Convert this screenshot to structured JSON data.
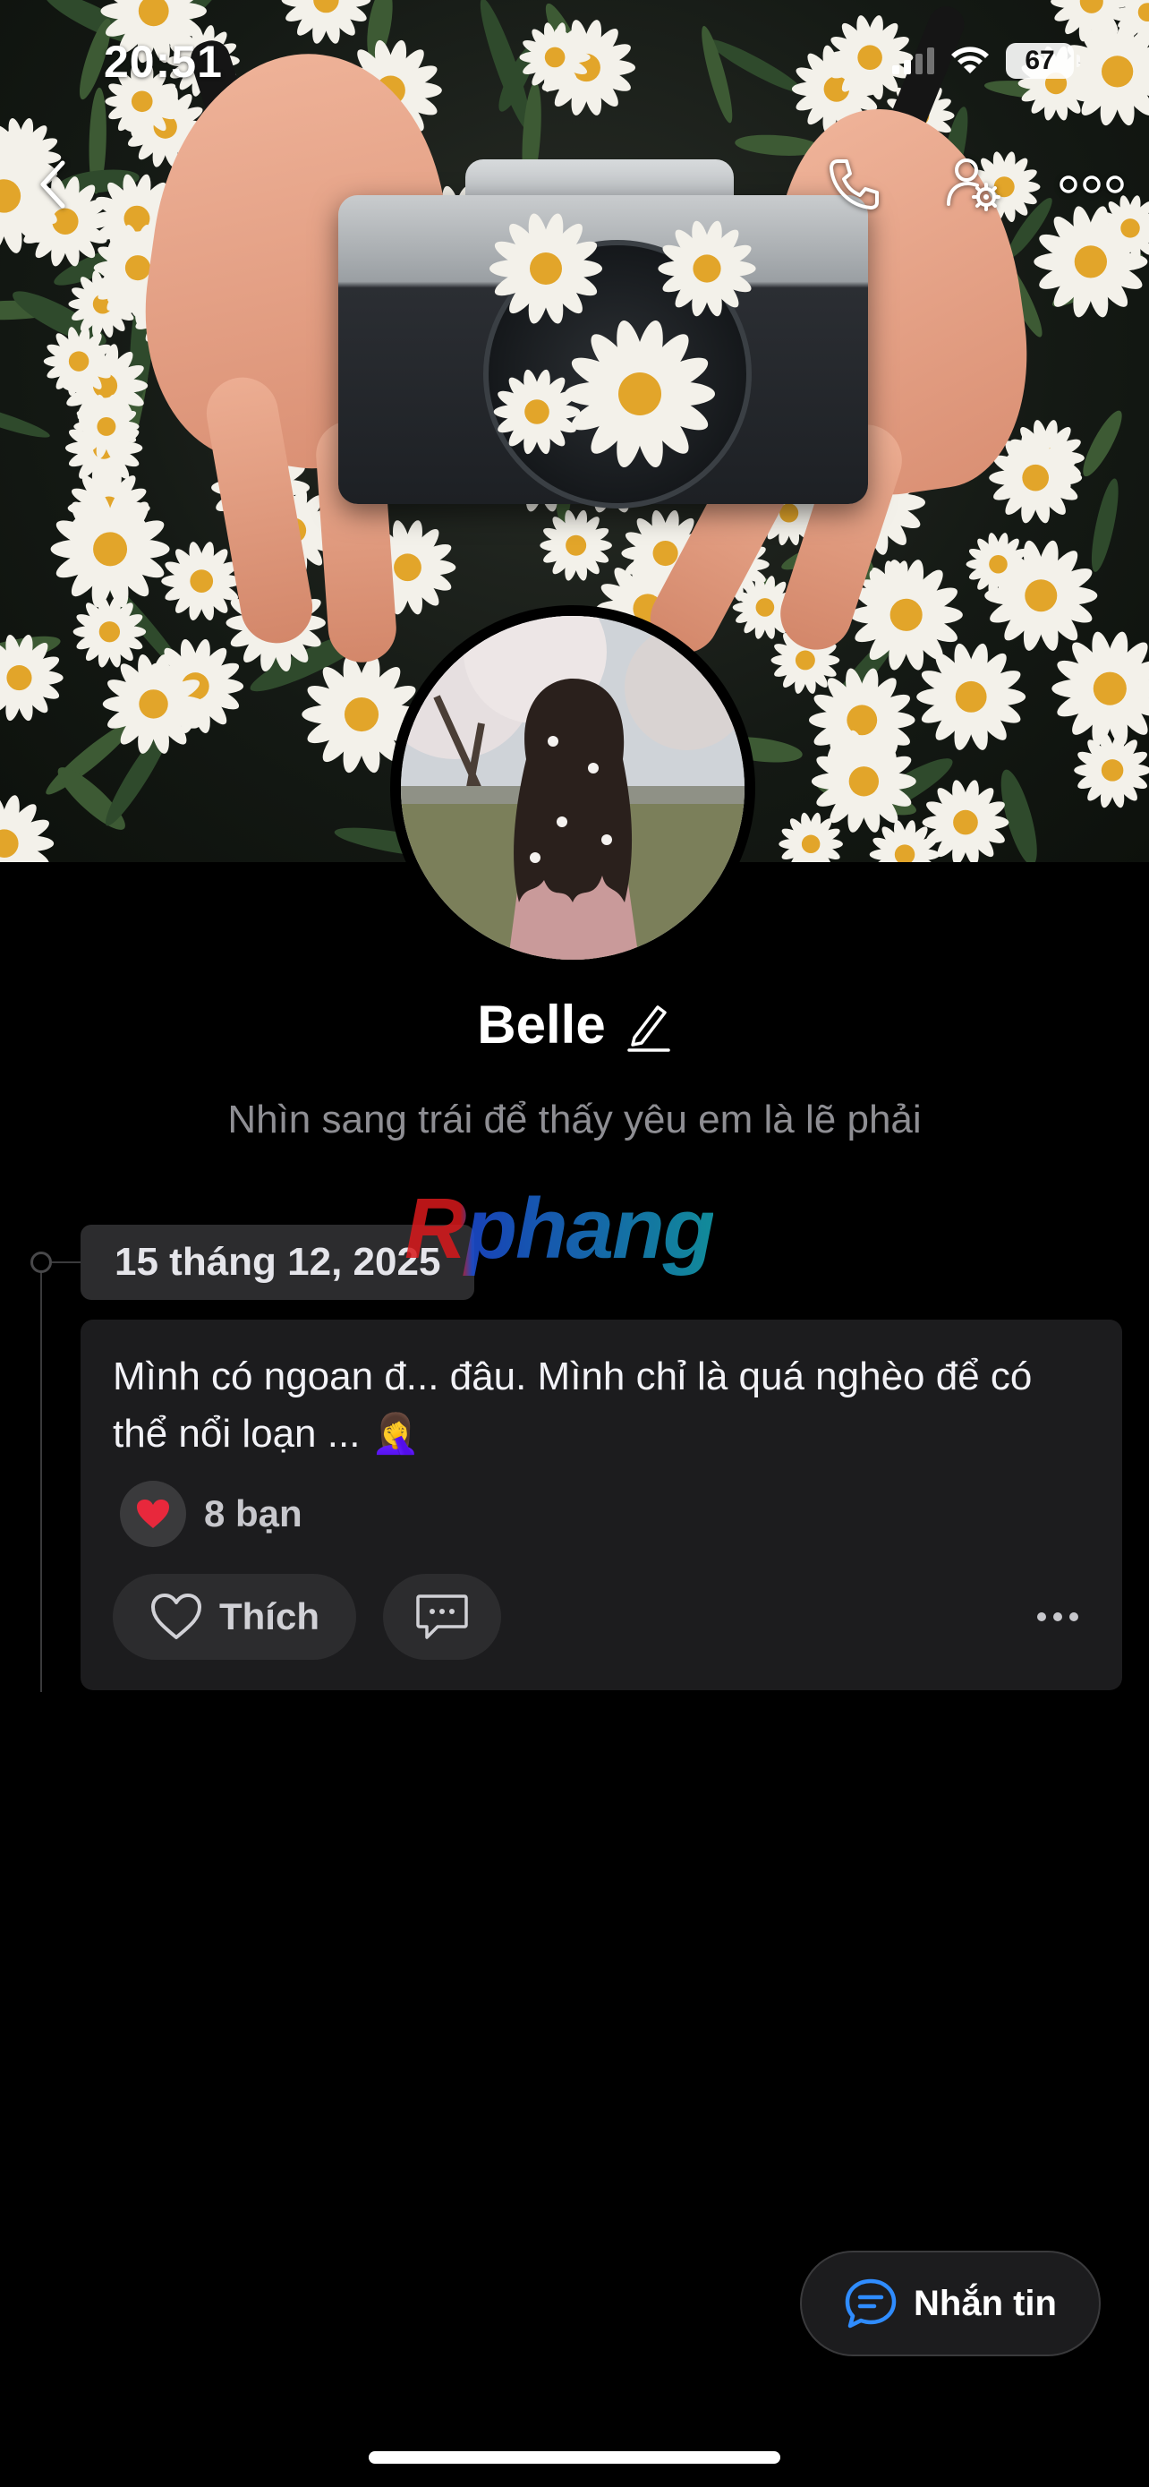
{
  "status_bar": {
    "time": "20:51",
    "battery": "67"
  },
  "nav": {
    "back_icon": "chevron-left-icon",
    "call_icon": "phone-icon",
    "settings_icon": "user-settings-icon",
    "more_icon": "more-horizontal-icon"
  },
  "profile": {
    "name": "Belle",
    "edit_icon": "pencil-icon",
    "bio": "Nhìn sang trái để thấy yêu em là lẽ phải"
  },
  "watermark": "Rphang",
  "timeline": {
    "date": "15 tháng 12, 2025"
  },
  "post": {
    "text": "Mình có ngoan đ... đâu. Mình chỉ là quá nghèo để có thể nổi loạn ... 🤦‍♀️",
    "reaction_icon": "heart-icon",
    "reaction_count": "8 bạn",
    "like_label": "Thích",
    "comment_icon": "comment-icon",
    "more_icon": "more-dots-icon"
  },
  "message_button": {
    "label": "Nhắn tin",
    "icon": "chat-bubble-icon"
  },
  "colors": {
    "background": "#000000",
    "card": "#1c1c1e",
    "chip": "#2c2c2e",
    "muted_text": "#8e8e93",
    "accent_blue": "#2f8cff",
    "heart_red": "#e8283c"
  }
}
